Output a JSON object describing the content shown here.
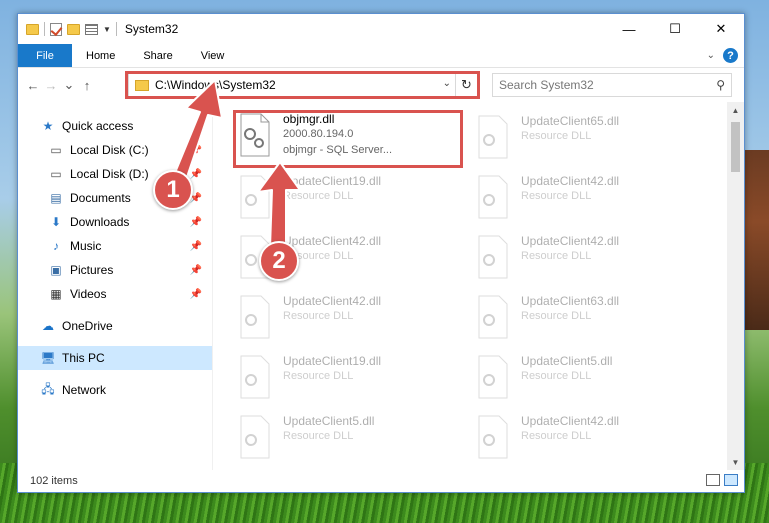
{
  "window": {
    "title": "System32",
    "controls": {
      "minimize": "—",
      "maximize": "☐",
      "close": "✕"
    }
  },
  "ribbon": {
    "tabs": [
      {
        "label": "File"
      },
      {
        "label": "Home"
      },
      {
        "label": "Share"
      },
      {
        "label": "View"
      }
    ],
    "help": "?"
  },
  "navigation": {
    "back": "←",
    "forward": "→",
    "recent": "⌄",
    "up": "↑",
    "address": "C:\\Windows\\System32",
    "search_placeholder": "Search System32"
  },
  "sidebar": {
    "items": [
      {
        "label": "Quick access",
        "icon": "star-icon",
        "level": "top"
      },
      {
        "label": "Local Disk (C:)",
        "icon": "drive-icon",
        "pinned": true
      },
      {
        "label": "Local Disk (D:)",
        "icon": "drive-icon",
        "pinned": true
      },
      {
        "label": "Documents",
        "icon": "documents-icon",
        "pinned": true
      },
      {
        "label": "Downloads",
        "icon": "downloads-icon",
        "pinned": true
      },
      {
        "label": "Music",
        "icon": "music-icon",
        "pinned": true
      },
      {
        "label": "Pictures",
        "icon": "pictures-icon",
        "pinned": true
      },
      {
        "label": "Videos",
        "icon": "videos-icon",
        "pinned": true
      },
      {
        "label": "OneDrive",
        "icon": "cloud-icon",
        "level": "top"
      },
      {
        "label": "This PC",
        "icon": "computer-icon",
        "level": "top",
        "selected": true
      },
      {
        "label": "Network",
        "icon": "network-icon",
        "level": "top"
      }
    ]
  },
  "files": [
    {
      "name": "objmgr.dll",
      "line2": "2000.80.194.0",
      "line3": "objmgr - SQL Server...",
      "highlighted": true
    },
    {
      "name": "UpdateClient65.dll",
      "line2": "Resource DLL"
    },
    {
      "name": "UpdateClient19.dll",
      "line2": "Resource DLL"
    },
    {
      "name": "UpdateClient42.dll",
      "line2": "Resource DLL"
    },
    {
      "name": "UpdateClient42.dll",
      "line2": "Resource DLL"
    },
    {
      "name": "UpdateClient42.dll",
      "line2": "Resource DLL"
    },
    {
      "name": "UpdateClient42.dll",
      "line2": "Resource DLL"
    },
    {
      "name": "UpdateClient63.dll",
      "line2": "Resource DLL"
    },
    {
      "name": "UpdateClient19.dll",
      "line2": "Resource DLL"
    },
    {
      "name": "UpdateClient5.dll",
      "line2": "Resource DLL"
    },
    {
      "name": "UpdateClient5.dll",
      "line2": "Resource DLL"
    },
    {
      "name": "UpdateClient42.dll",
      "line2": "Resource DLL"
    }
  ],
  "status": {
    "item_count": "102 items"
  },
  "callouts": {
    "one": "1",
    "two": "2"
  },
  "colors": {
    "accent": "#1979ca",
    "highlight": "#d9534f",
    "selected": "#cde8ff"
  }
}
